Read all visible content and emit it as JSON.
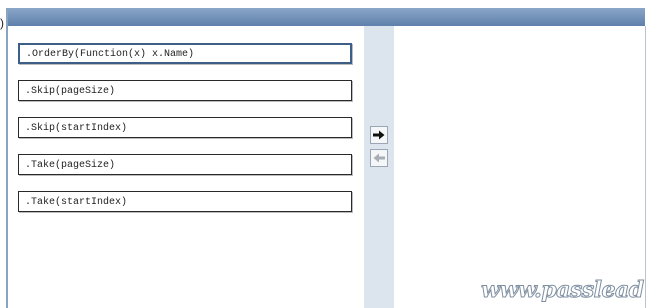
{
  "corner_mark": ")",
  "source_items": [
    {
      "label": ".OrderBy(Function(x) x.Name)"
    },
    {
      "label": ".Skip(pageSize)"
    },
    {
      "label": ".Skip(startIndex)"
    },
    {
      "label": ".Take(pageSize)"
    },
    {
      "label": ".Take(startIndex)"
    }
  ],
  "buttons": {
    "move_right_icon": "arrow-right-icon",
    "move_left_icon": "arrow-left-icon"
  },
  "watermark": "www.passlead",
  "colors": {
    "header": "#6f8fb9",
    "gutter": "#dce5ee",
    "selected_border": "#3d5f86"
  }
}
